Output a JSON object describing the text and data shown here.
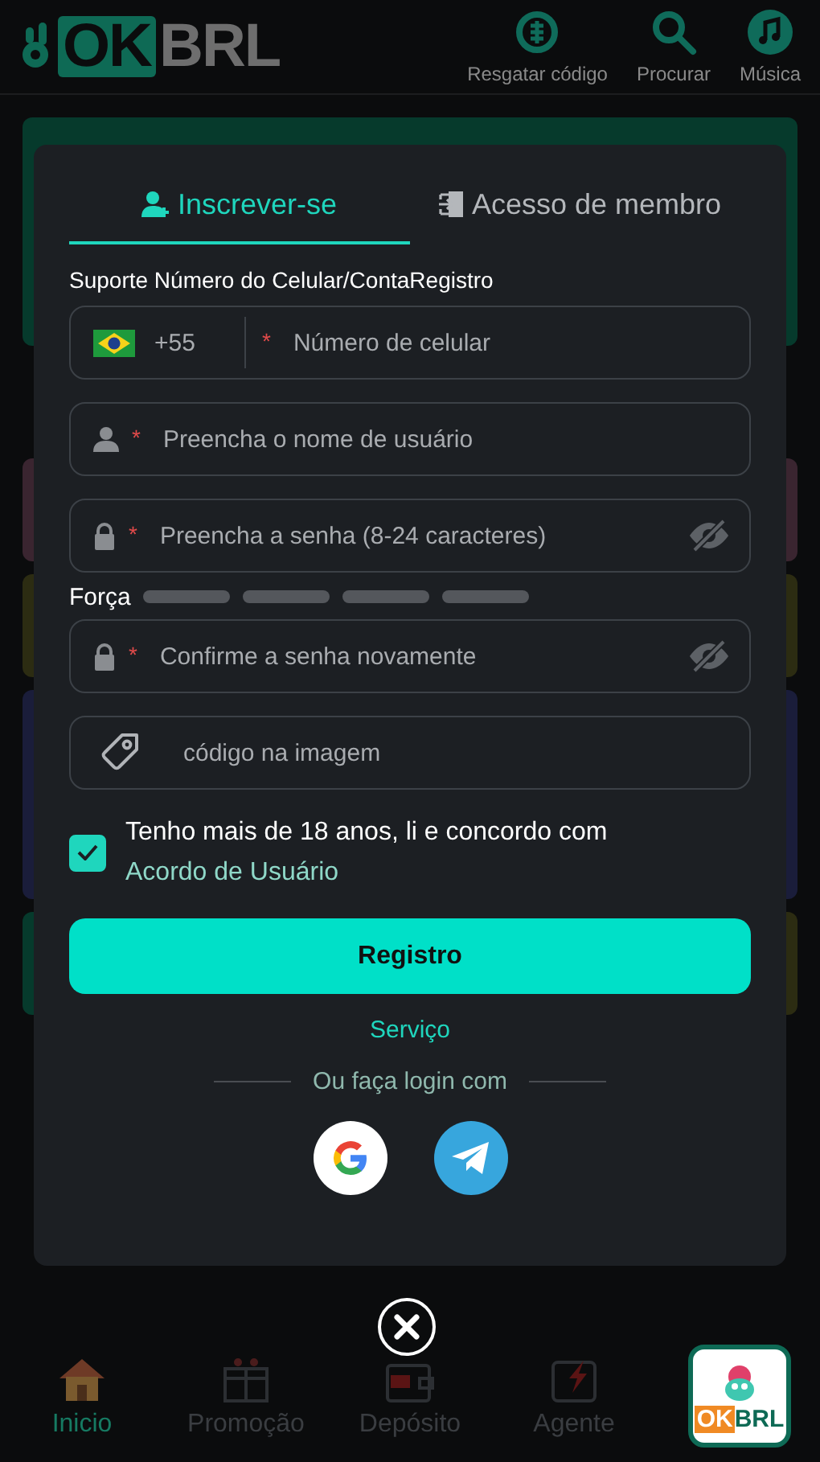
{
  "header": {
    "logo": {
      "mark": "OK",
      "text": "BRL"
    },
    "actions": [
      {
        "kind": "redeem",
        "label": "Resgatar código"
      },
      {
        "kind": "search",
        "label": "Procurar"
      },
      {
        "kind": "music",
        "label": "Música"
      }
    ]
  },
  "modal": {
    "tabs": [
      {
        "kind": "signup",
        "label": "Inscrever-se",
        "selected": true
      },
      {
        "kind": "login",
        "label": "Acesso de membro",
        "selected": false
      }
    ],
    "hint": "Suporte Número do Celular/ContaRegistro",
    "fields": [
      {
        "kind": "phone",
        "code": "+55",
        "mark": "*",
        "placeholder": "Número de celular"
      },
      {
        "kind": "user",
        "mark": "*",
        "placeholder": "Preencha o nome de usuário"
      },
      {
        "kind": "password",
        "mark": "*",
        "placeholder": "Preencha a senha (8-24 caracteres)"
      },
      {
        "kind": "strength",
        "label": "Força"
      },
      {
        "kind": "password",
        "mark": "*",
        "placeholder": "Confirme a senha novamente"
      },
      {
        "kind": "captcha",
        "placeholder": "código na imagem"
      }
    ],
    "agree": {
      "checked": true,
      "text": "Tenho mais de 18 anos, li e concordo com ",
      "link": "Acordo de Usuário"
    },
    "submit": "Registro",
    "service": "Serviço",
    "divider": "Ou faça login com",
    "social": [
      {
        "kind": "google"
      },
      {
        "kind": "telegram"
      }
    ]
  },
  "nav": [
    {
      "kind": "home",
      "label": "Inicio",
      "selected": true
    },
    {
      "kind": "gift",
      "label": "Promoção",
      "selected": false
    },
    {
      "kind": "wallet",
      "label": "Depósito",
      "selected": false
    },
    {
      "kind": "agent",
      "label": "Agente",
      "selected": false
    }
  ],
  "badge": {
    "mark": "OK",
    "text": "BRL"
  }
}
